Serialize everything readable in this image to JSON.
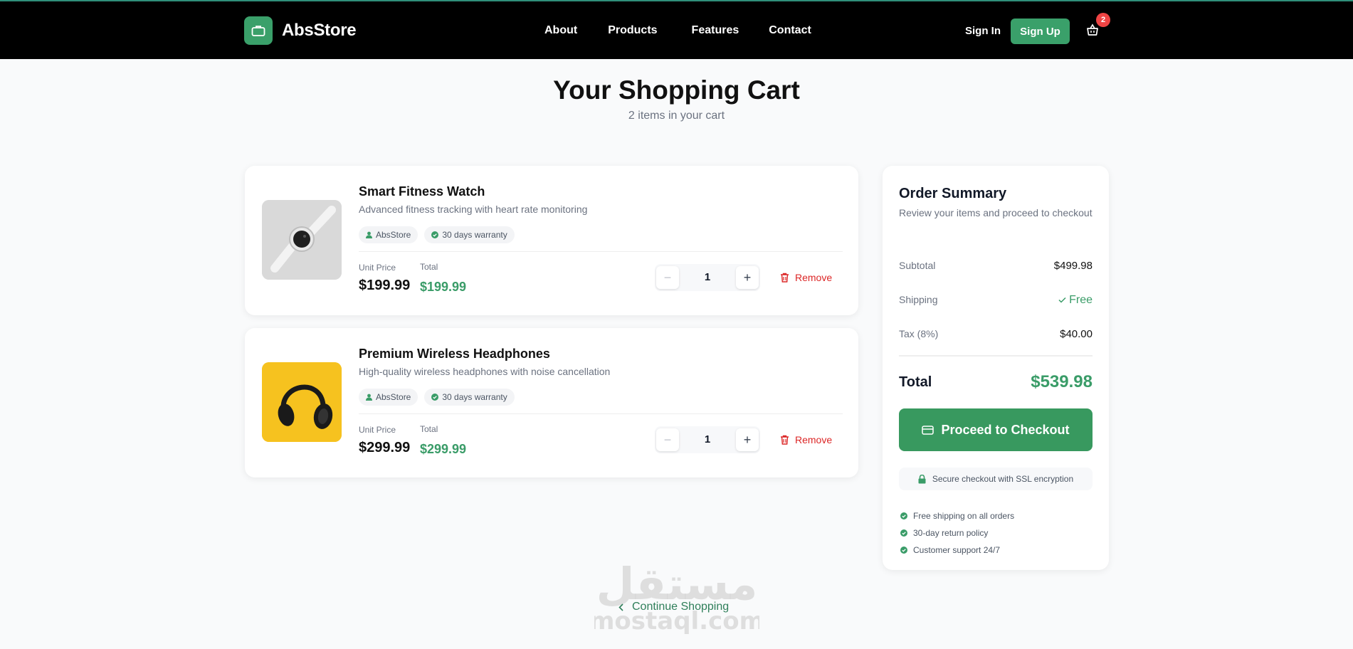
{
  "header": {
    "brand": "AbsStore",
    "nav": [
      "About",
      "Products",
      "Features",
      "Contact"
    ],
    "sign_in": "Sign In",
    "sign_up": "Sign Up",
    "cart_count": "2"
  },
  "page": {
    "title": "Your Shopping Cart",
    "subtitle": "2 items in your cart"
  },
  "items": [
    {
      "name": "Smart Fitness Watch",
      "description": "Advanced fitness tracking with heart rate monitoring",
      "tags": [
        "AbsStore",
        "30 days warranty"
      ],
      "unit_label": "Unit Price",
      "total_label": "Total",
      "unit_price": "$199.99",
      "total": "$199.99",
      "quantity": "1",
      "remove": "Remove"
    },
    {
      "name": "Premium Wireless Headphones",
      "description": "High-quality wireless headphones with noise cancellation",
      "tags": [
        "AbsStore",
        "30 days warranty"
      ],
      "unit_label": "Unit Price",
      "total_label": "Total",
      "unit_price": "$299.99",
      "total": "$299.99",
      "quantity": "1",
      "remove": "Remove"
    }
  ],
  "summary": {
    "title": "Order Summary",
    "subtitle": "Review your items and proceed to checkout",
    "rows": [
      {
        "label": "Subtotal",
        "value": "$499.98"
      },
      {
        "label": "Shipping",
        "value": "Free"
      },
      {
        "label": "Tax (8%)",
        "value": "$40.00"
      }
    ],
    "total_label": "Total",
    "total_value": "$539.98",
    "checkout": "Proceed to Checkout",
    "secure": "Secure checkout with SSL encryption",
    "perks": [
      "Free shipping on all orders",
      "30-day return policy",
      "Customer support 24/7"
    ]
  },
  "continue": "Continue Shopping",
  "watermark": {
    "arabic": "مستقل",
    "latin": "mostaql.com"
  },
  "colors": {
    "accent": "#3aa06a",
    "danger": "#dc2626",
    "header": "#000000"
  }
}
